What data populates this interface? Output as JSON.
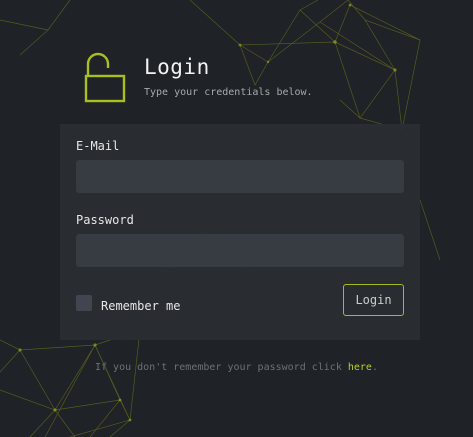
{
  "header": {
    "title": "Login",
    "subtitle": "Type your credentials below.",
    "icon": "unlock-icon"
  },
  "form": {
    "email_label": "E-Mail",
    "email_value": "",
    "password_label": "Password",
    "password_value": "",
    "remember_label": "Remember me",
    "remember_checked": false,
    "submit_label": "Login"
  },
  "footer": {
    "text_before": "If you don't remember your password click ",
    "link_text": "here",
    "text_after": "."
  },
  "colors": {
    "background": "#1f2226",
    "card": "#2a2d32",
    "input": "#383c43",
    "accent": "#a8c01f",
    "link": "#b8d12b"
  }
}
